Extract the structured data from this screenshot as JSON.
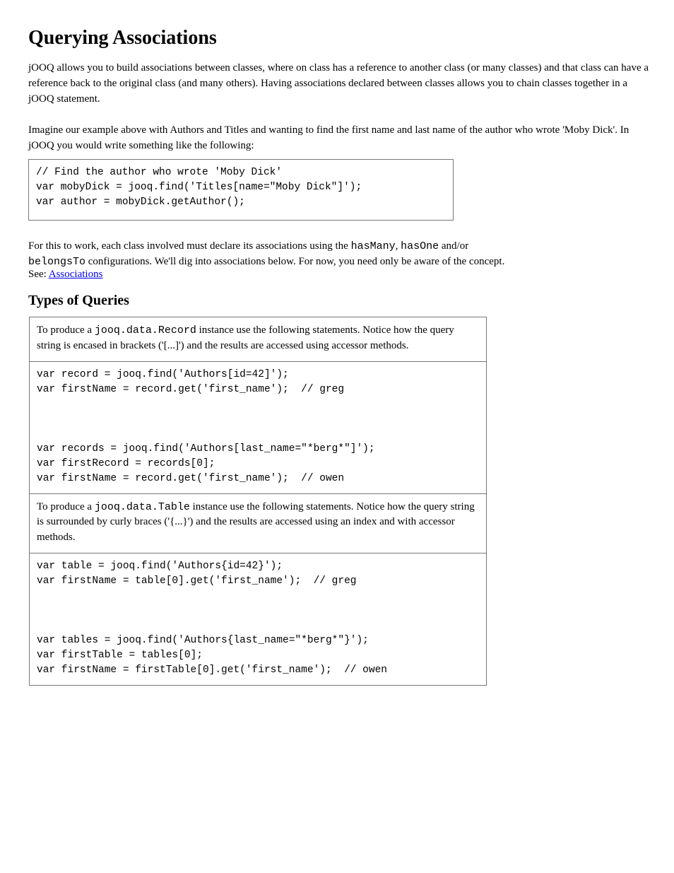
{
  "heading": "Querying Associations",
  "intro_p1": "jOOQ allows you to build associations between classes, where on class has a reference to another class (or many classes) and that class can have a reference back to the original class (and many others). Having associations declared between classes allows you to chain classes together in a jOOQ statement.",
  "intro_p2": "Imagine our example above with Authors and Titles and wanting to find the first name and last name of the author who wrote 'Moby Dick'. In jOOQ you would write something like the following:",
  "code_top": "// Find the author who wrote 'Moby Dick'\nvar mobyDick = jooq.find('Titles[name=\"Moby Dick\"]');\nvar author = mobyDick.getAuthor();",
  "explain_line1_pre": "For this to work, each class involved must declare its associations using the ",
  "explain_line1_code1": "hasMany",
  "explain_line1_mid": ", ",
  "explain_line1_code2": "hasOne",
  "explain_line1_post": " and/or",
  "explain_line2_code": "belongsTo",
  "explain_line2_post": " configurations. We'll dig into associations below. For now, you need only be aware of the concept.",
  "see_label": "See: ",
  "see_link": "Associations",
  "types_heading": "Types of Queries",
  "row1_desc_pre": "To produce a ",
  "row1_desc_code": "jooq.data.Record",
  "row1_desc_post": " instance use the following statements. Notice how the query string is encased in brackets ('[...]') and the results are accessed using accessor methods.",
  "row1_code": "var record = jooq.find('Authors[id=42]');\nvar firstName = record.get('first_name');  // greg\n\n\n\nvar records = jooq.find('Authors[last_name=\"*berg*\"]');\nvar firstRecord = records[0];\nvar firstName = record.get('first_name');  // owen",
  "row2_desc_pre": "To produce a ",
  "row2_desc_code": "jooq.data.Table",
  "row2_desc_post": " instance use the following statements. Notice how the query string is surrounded by curly braces ('{...}') and the results are accessed using an index and with accessor methods.",
  "row2_code": "var table = jooq.find('Authors{id=42}');\nvar firstName = table[0].get('first_name');  // greg\n\n\n\nvar tables = jooq.find('Authors{last_name=\"*berg*\"}');\nvar firstTable = tables[0];\nvar firstName = firstTable[0].get('first_name');  // owen\n"
}
